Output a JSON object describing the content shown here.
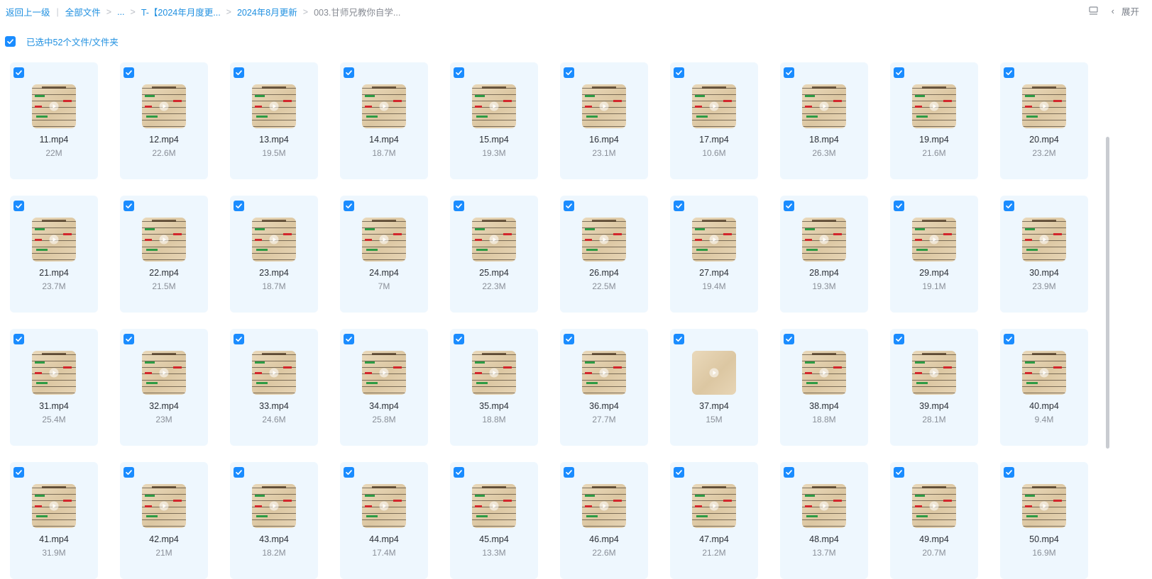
{
  "breadcrumb": {
    "back": "返回上一级",
    "all_files": "全部文件",
    "ellipsis": "...",
    "folder1": "T-【2024年月度更...",
    "folder2": "2024年8月更新",
    "current": "003.甘师兄教你自学..."
  },
  "toolbar": {
    "expand_label": "展开",
    "list_view_icon": "list-view-icon",
    "chevron_icon": "chevron-left-icon"
  },
  "selection": {
    "text": "已选中52个文件/文件夹",
    "checked": true
  },
  "colors": {
    "accent": "#1a8cff",
    "link": "#1e8fe0",
    "card_bg": "#eef7fe"
  },
  "files": [
    {
      "name": "11.mp4",
      "size": "22M"
    },
    {
      "name": "12.mp4",
      "size": "22.6M"
    },
    {
      "name": "13.mp4",
      "size": "19.5M"
    },
    {
      "name": "14.mp4",
      "size": "18.7M"
    },
    {
      "name": "15.mp4",
      "size": "19.3M"
    },
    {
      "name": "16.mp4",
      "size": "23.1M"
    },
    {
      "name": "17.mp4",
      "size": "10.6M"
    },
    {
      "name": "18.mp4",
      "size": "26.3M"
    },
    {
      "name": "19.mp4",
      "size": "21.6M"
    },
    {
      "name": "20.mp4",
      "size": "23.2M"
    },
    {
      "name": "21.mp4",
      "size": "23.7M"
    },
    {
      "name": "22.mp4",
      "size": "21.5M"
    },
    {
      "name": "23.mp4",
      "size": "18.7M"
    },
    {
      "name": "24.mp4",
      "size": "7M"
    },
    {
      "name": "25.mp4",
      "size": "22.3M"
    },
    {
      "name": "26.mp4",
      "size": "22.5M"
    },
    {
      "name": "27.mp4",
      "size": "19.4M"
    },
    {
      "name": "28.mp4",
      "size": "19.3M"
    },
    {
      "name": "29.mp4",
      "size": "19.1M"
    },
    {
      "name": "30.mp4",
      "size": "23.9M"
    },
    {
      "name": "31.mp4",
      "size": "25.4M"
    },
    {
      "name": "32.mp4",
      "size": "23M"
    },
    {
      "name": "33.mp4",
      "size": "24.6M"
    },
    {
      "name": "34.mp4",
      "size": "25.8M"
    },
    {
      "name": "35.mp4",
      "size": "18.8M"
    },
    {
      "name": "36.mp4",
      "size": "27.7M"
    },
    {
      "name": "37.mp4",
      "size": "15M"
    },
    {
      "name": "38.mp4",
      "size": "18.8M"
    },
    {
      "name": "39.mp4",
      "size": "28.1M"
    },
    {
      "name": "40.mp4",
      "size": "9.4M"
    },
    {
      "name": "41.mp4",
      "size": "31.9M"
    },
    {
      "name": "42.mp4",
      "size": "21M"
    },
    {
      "name": "43.mp4",
      "size": "18.2M"
    },
    {
      "name": "44.mp4",
      "size": "17.4M"
    },
    {
      "name": "45.mp4",
      "size": "13.3M"
    },
    {
      "name": "46.mp4",
      "size": "22.6M"
    },
    {
      "name": "47.mp4",
      "size": "21.2M"
    },
    {
      "name": "48.mp4",
      "size": "13.7M"
    },
    {
      "name": "49.mp4",
      "size": "20.7M"
    },
    {
      "name": "50.mp4",
      "size": "16.9M"
    }
  ]
}
